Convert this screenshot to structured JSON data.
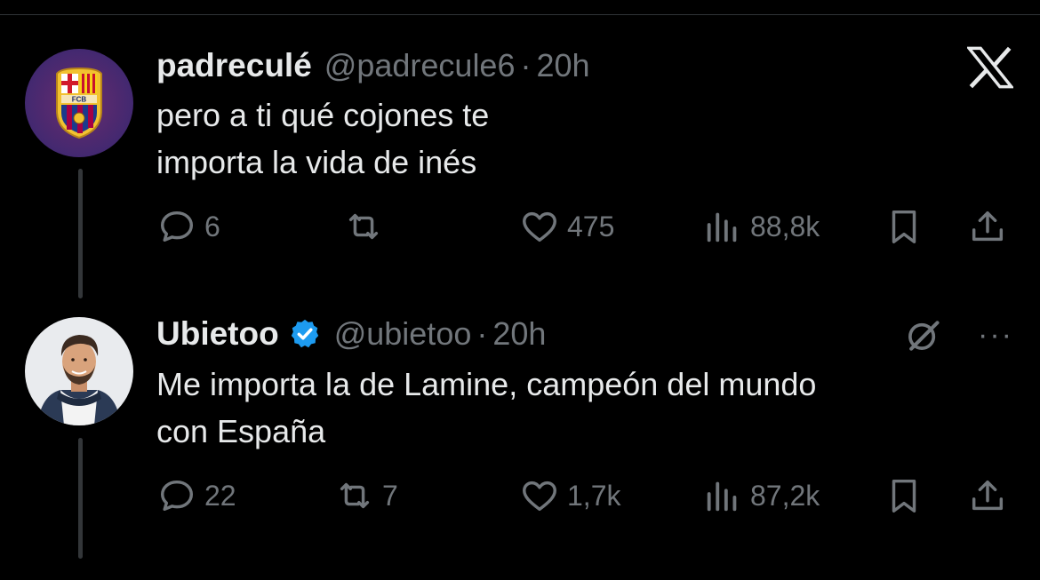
{
  "brand": {
    "logo_icon": "x-logo-icon"
  },
  "tweets": [
    {
      "display_name": "padreculé",
      "handle": "@padrecule6",
      "dot": "·",
      "time": "20h",
      "text_lines": [
        "pero a ti qué cojones te",
        "importa la vida de inés"
      ],
      "avatar": "fc-barcelona-crest",
      "stats": {
        "replies": "6",
        "retweets": "",
        "likes": "475",
        "views": "88,8k"
      }
    },
    {
      "display_name": "Ubietoo",
      "verified": true,
      "handle": "@ubietoo",
      "dot": "·",
      "time": "20h",
      "text_lines": [
        "Me importa la de Lamine, campeón del mundo",
        "con España"
      ],
      "avatar": "profile-photo",
      "more": "···",
      "stats": {
        "replies": "22",
        "retweets": "7",
        "likes": "1,7k",
        "views": "87,2k"
      }
    }
  ],
  "colors": {
    "background": "#000000",
    "text": "#e7e9ea",
    "muted": "#71767b",
    "verified": "#1d9bf0"
  }
}
